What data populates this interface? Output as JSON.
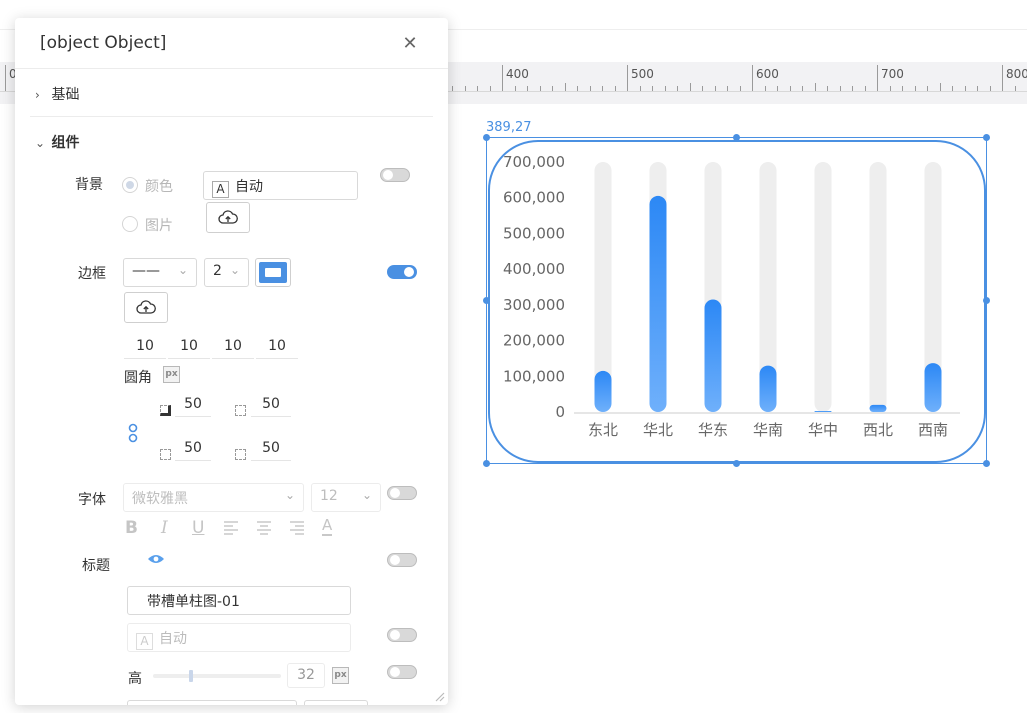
{
  "panel": {
    "title": {
      "label": "标题",
      "value": "带槽单柱图-01",
      "color_value": "自动",
      "color_icon_letter": "A",
      "height_label": "高",
      "height_value": "32",
      "px_badge": "px",
      "height_fraction": 0.3
    },
    "sections": {
      "basic": "基础",
      "component": "组件"
    },
    "background": {
      "label": "背景",
      "option_color": "颜色",
      "option_image": "图片",
      "color_value": "自动",
      "color_icon_letter": "A"
    },
    "border": {
      "label": "边框",
      "line_style": "——",
      "width": "2",
      "widths": [
        "10",
        "10",
        "10",
        "10"
      ],
      "radius_label": "圆角",
      "px_badge": "px",
      "radii": [
        "50",
        "50",
        "50",
        "50"
      ],
      "color": "#4a90e2"
    },
    "font": {
      "label": "字体",
      "family": "微软雅黑",
      "size": "12",
      "format_bold": "B",
      "format_italic": "I",
      "format_underline": "U",
      "format_color_letter": "A"
    }
  },
  "canvas": {
    "coord_readout": "389,27",
    "ruler_labels": [
      "0",
      "400",
      "500",
      "600",
      "700",
      "800"
    ]
  },
  "chart_data": {
    "type": "bar",
    "categories": [
      "东北",
      "华北",
      "华东",
      "华南",
      "华中",
      "西北",
      "西南"
    ],
    "values": [
      115000,
      605000,
      315000,
      130000,
      2000,
      20000,
      137000
    ],
    "ylim": [
      0,
      700000
    ],
    "yticks": [
      "0",
      "100,000",
      "200,000",
      "300,000",
      "400,000",
      "500,000",
      "600,000",
      "700,000"
    ],
    "title": "",
    "xlabel": "",
    "ylabel": "",
    "grid": false,
    "bar_color_top": "#2c88f5",
    "bar_color_bottom": "#6fb0fb",
    "track_color": "#eeeeee"
  }
}
